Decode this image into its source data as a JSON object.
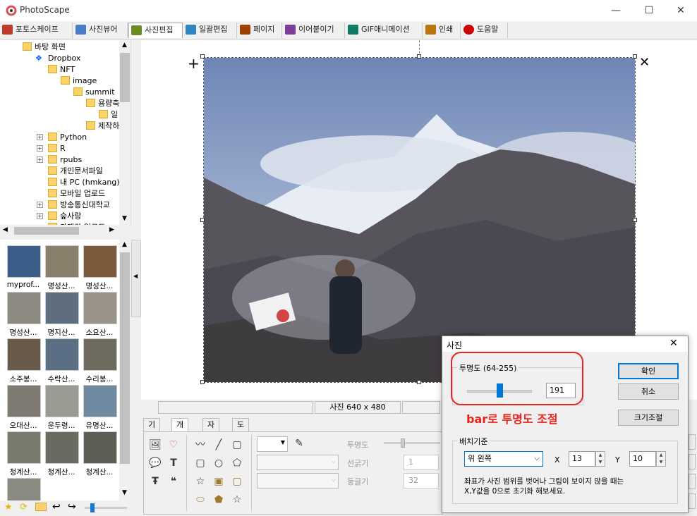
{
  "window": {
    "title": "PhotoScape",
    "minimize": "—",
    "maximize": "☐",
    "close": "✕"
  },
  "menu": [
    {
      "label": "포토스케이프",
      "color": "#c0392b"
    },
    {
      "label": "사진뷰어",
      "color": "#4a7ec8"
    },
    {
      "label": "사진편집",
      "color": "#6b8e23"
    },
    {
      "label": "일괄편집",
      "color": "#2e86c1"
    },
    {
      "label": "페이지",
      "color": "#a04000"
    },
    {
      "label": "이어붙이기",
      "color": "#7d3c98"
    },
    {
      "label": "GIF애니메이션",
      "color": "#117a65"
    },
    {
      "label": "인쇄",
      "color": "#b9770e"
    },
    {
      "label": "도움말",
      "color": "#cc0000"
    }
  ],
  "tree": [
    {
      "label": "바탕 화면",
      "level": 1
    },
    {
      "label": "Dropbox",
      "level": 2,
      "dropbox": true
    },
    {
      "label": "NFT",
      "level": 3
    },
    {
      "label": "image",
      "level": 4
    },
    {
      "label": "summit",
      "level": 5
    },
    {
      "label": "용량축",
      "level": 6
    },
    {
      "label": "일",
      "level": 7
    },
    {
      "label": "제작하",
      "level": 6
    },
    {
      "label": "Python",
      "level": 3,
      "plus": true
    },
    {
      "label": "R",
      "level": 3,
      "plus": true
    },
    {
      "label": "rpubs",
      "level": 3,
      "plus": true
    },
    {
      "label": "개인문서파일",
      "level": 3
    },
    {
      "label": "내 PC (hmkang)",
      "level": 3
    },
    {
      "label": "모바일 업로드",
      "level": 3
    },
    {
      "label": "방송통신대학교",
      "level": 3,
      "plus": true
    },
    {
      "label": "숲사랑",
      "level": 3,
      "plus": true
    },
    {
      "label": "카메라 업로드",
      "level": 3
    }
  ],
  "thumbnails": [
    {
      "label": "myprof...",
      "color": "#3b5f8a"
    },
    {
      "label": "명성산...",
      "color": "#8a7f6a"
    },
    {
      "label": "명성산...",
      "color": "#7a5a3a"
    },
    {
      "label": "명성산...",
      "color": "#8d8a82"
    },
    {
      "label": "명지산...",
      "color": "#5f6e7e"
    },
    {
      "label": "소요산...",
      "color": "#9a938a"
    },
    {
      "label": "소주봉...",
      "color": "#6a5a4a"
    },
    {
      "label": "수락산...",
      "color": "#5a6f84"
    },
    {
      "label": "수리봉...",
      "color": "#6e6a5e"
    },
    {
      "label": "오대산...",
      "color": "#7e7a72"
    },
    {
      "label": "운두령...",
      "color": "#9a9a92"
    },
    {
      "label": "유명산...",
      "color": "#6f8aa0"
    },
    {
      "label": "청계산...",
      "color": "#7a7a6e"
    },
    {
      "label": "청계산...",
      "color": "#6a6a60"
    },
    {
      "label": "청계산...",
      "color": "#5e5e56"
    },
    {
      "label": "",
      "color": "#8a8a80"
    }
  ],
  "status": {
    "size": "사진 640 x 480"
  },
  "bottom_tabs": [
    "기본",
    "개체",
    "자르기",
    "도구"
  ],
  "bottom_panel": {
    "opacity_label": "투명도",
    "line_label": "선굵기",
    "line_value": "1",
    "round_label": "둥글기",
    "round_value": "32"
  },
  "dialog": {
    "title": "사진",
    "opacity_group": "투명도 (64-255)",
    "opacity_value": "191",
    "opacity_fraction": 0.5,
    "annotation": "bar로 투명도 조절",
    "annotation_color": "#e8251c",
    "ok": "확인",
    "cancel": "취소",
    "resize": "크기조절",
    "position_group": "배치기준",
    "position_select": "위 왼쪽",
    "x_label": "X",
    "x_value": "13",
    "y_label": "Y",
    "y_value": "10",
    "note": "좌표가 사진 범위를 벗어나 그림이 보이지 않을 때는\nX,Y값을 0으로 초기화 해보세요."
  }
}
